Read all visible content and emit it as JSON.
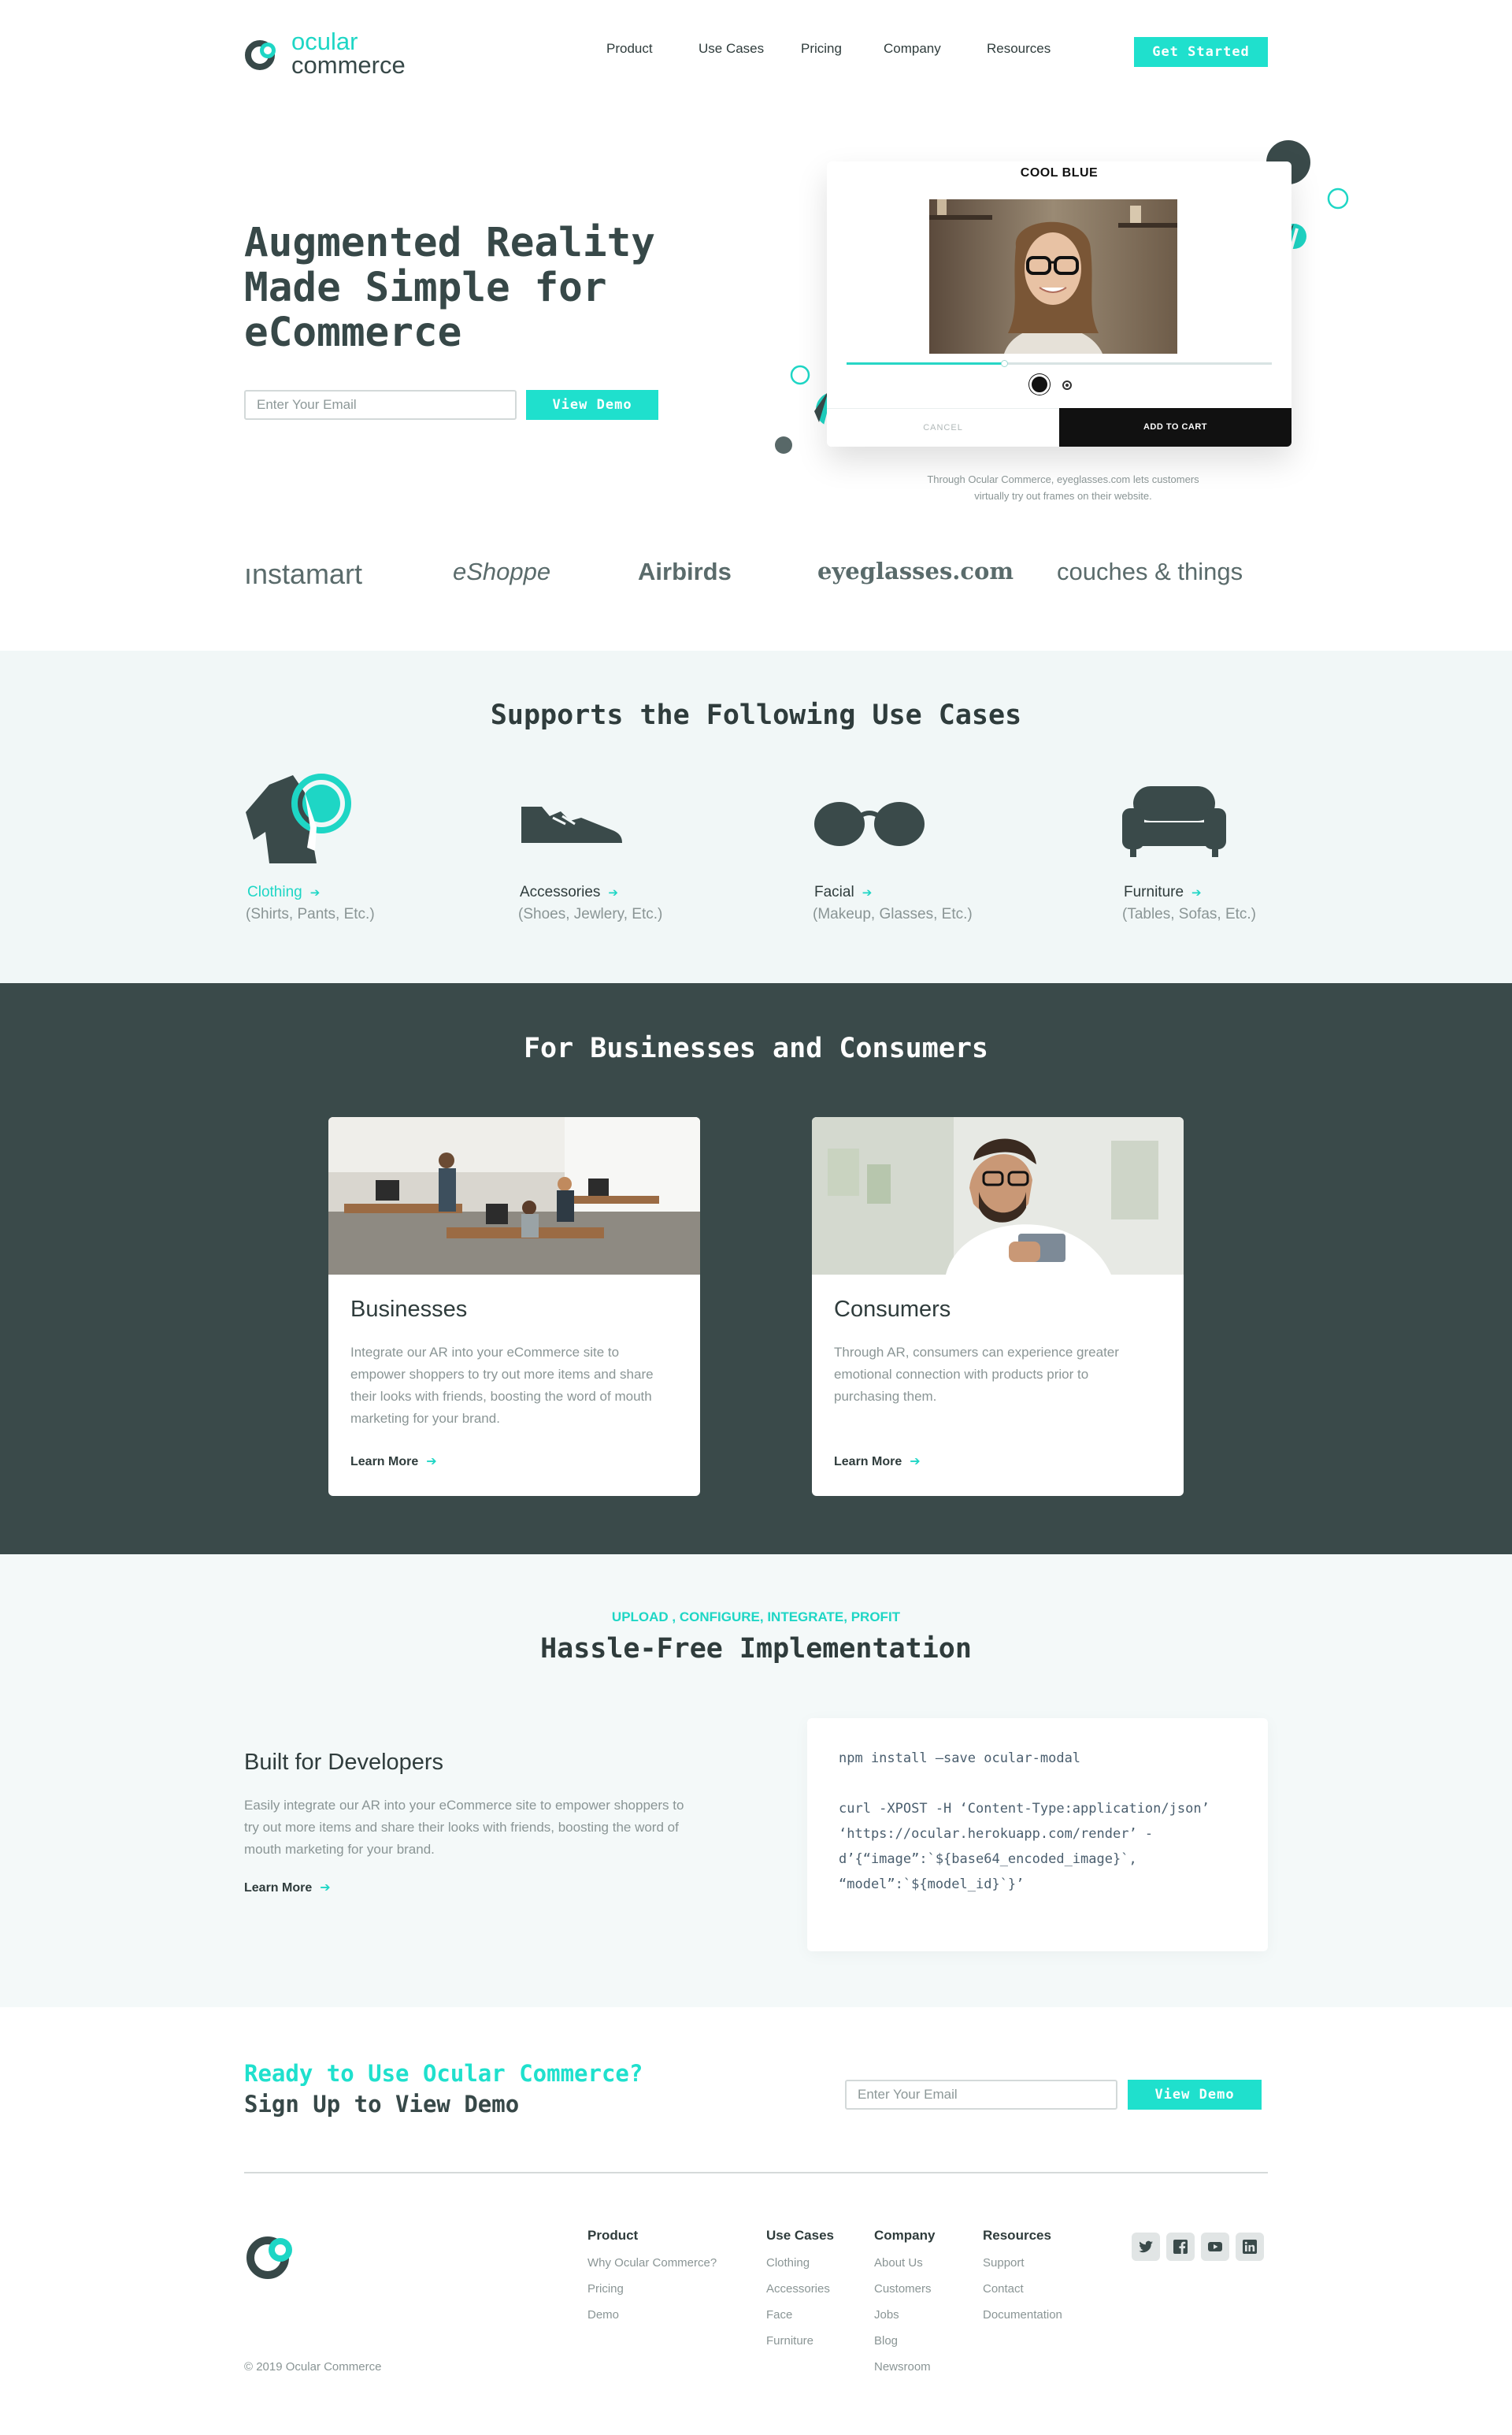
{
  "brand": {
    "name_line1": "ocular",
    "name_line2": "commerce",
    "accent": "#1ed6c5",
    "dark": "#374848"
  },
  "nav": {
    "items": [
      "Product",
      "Use Cases",
      "Pricing",
      "Company",
      "Resources"
    ],
    "cta": "Get Started"
  },
  "hero": {
    "title_l1": "Augmented Reality",
    "title_l2": "Made Simple for",
    "title_l3": "eCommerce",
    "email_placeholder": "Enter Your Email",
    "demo_button": "View Demo"
  },
  "ar_widget": {
    "title": "COOL BLUE",
    "cancel": "CANCEL",
    "add_to_cart": "ADD TO CART",
    "caption_l1": "Through Ocular Commerce, eyeglasses.com lets customers",
    "caption_l2": "virtually try out frames on their website."
  },
  "brands": [
    "ınstamart",
    "eShoppe",
    "Airbirds",
    "eyeglasses.com",
    "couches & things"
  ],
  "use_cases": {
    "title": "Supports the Following Use Cases",
    "items": [
      {
        "label": "Clothing",
        "sub": "(Shirts, Pants, Etc.)",
        "icon": "clothing-icon"
      },
      {
        "label": "Accessories",
        "sub": "(Shoes, Jewlery, Etc.)",
        "icon": "shoe-icon"
      },
      {
        "label": "Facial",
        "sub": "(Makeup, Glasses, Etc.)",
        "icon": "glasses-icon"
      },
      {
        "label": "Furniture",
        "sub": "(Tables, Sofas, Etc.)",
        "icon": "sofa-icon"
      }
    ]
  },
  "audience": {
    "title": "For Businesses and Consumers",
    "cards": [
      {
        "heading": "Businesses",
        "body": "Integrate our AR into your eCommerce site to empower shoppers to try out more items and share their looks with friends, boosting the word of mouth marketing for your brand.",
        "link": "Learn More"
      },
      {
        "heading": "Consumers",
        "body": "Through AR, consumers can experience greater emotional connection with products prior to purchasing them.",
        "link": "Learn More"
      }
    ]
  },
  "implementation": {
    "eyebrow": "UPLOAD , CONFIGURE, INTEGRATE, PROFIT",
    "title": "Hassle-Free Implementation",
    "dev_heading": "Built for Developers",
    "dev_body": "Easily integrate our AR into your eCommerce site to empower shoppers to try out more items and share their looks with friends, boosting the word of mouth marketing for your brand.",
    "dev_link": "Learn More",
    "code": [
      "npm install —save ocular-modal",
      "",
      "curl -XPOST -H ‘Content-Type:application/json’",
      "‘https://ocular.herokuapp.com/render’ -",
      "d’{“image”:`${base64_encoded_image}`,",
      "“model”:`${model_id}`}’"
    ]
  },
  "cta": {
    "line1": "Ready to Use Ocular Commerce?",
    "line2": "Sign Up to View Demo",
    "email_placeholder": "Enter Your Email",
    "button": "View Demo"
  },
  "footer": {
    "columns": [
      {
        "heading": "Product",
        "links": [
          "Why Ocular Commerce?",
          "Pricing",
          "Demo"
        ]
      },
      {
        "heading": "Use Cases",
        "links": [
          "Clothing",
          "Accessories",
          "Face",
          "Furniture"
        ]
      },
      {
        "heading": "Company",
        "links": [
          "About Us",
          "Customers",
          "Jobs",
          "Blog",
          "Newsroom"
        ]
      },
      {
        "heading": "Resources",
        "links": [
          "Support",
          "Contact",
          "Documentation"
        ]
      }
    ],
    "social": [
      "twitter-icon",
      "facebook-icon",
      "youtube-icon",
      "linkedin-icon"
    ],
    "copyright": "© 2019 Ocular Commerce"
  }
}
